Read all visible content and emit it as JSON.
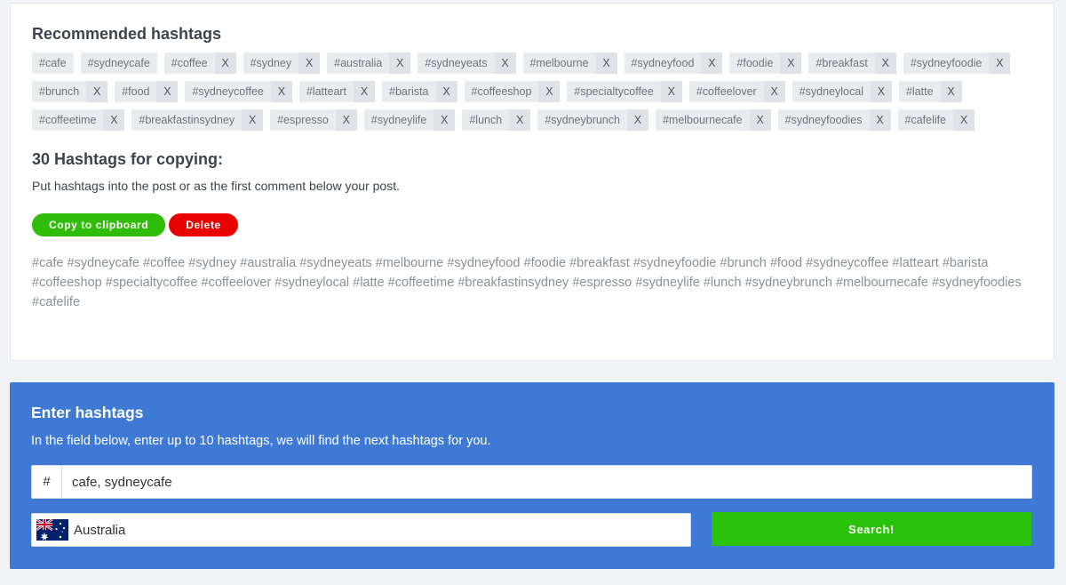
{
  "recommended": {
    "title": "Recommended hashtags",
    "tags": [
      {
        "label": "#cafe",
        "removable": false
      },
      {
        "label": "#sydneycafe",
        "removable": false
      },
      {
        "label": "#coffee",
        "removable": true
      },
      {
        "label": "#sydney",
        "removable": true
      },
      {
        "label": "#australia",
        "removable": true
      },
      {
        "label": "#sydneyeats",
        "removable": true
      },
      {
        "label": "#melbourne",
        "removable": true
      },
      {
        "label": "#sydneyfood",
        "removable": true
      },
      {
        "label": "#foodie",
        "removable": true
      },
      {
        "label": "#breakfast",
        "removable": true
      },
      {
        "label": "#sydneyfoodie",
        "removable": true
      },
      {
        "label": "#brunch",
        "removable": true
      },
      {
        "label": "#food",
        "removable": true
      },
      {
        "label": "#sydneycoffee",
        "removable": true
      },
      {
        "label": "#latteart",
        "removable": true
      },
      {
        "label": "#barista",
        "removable": true
      },
      {
        "label": "#coffeeshop",
        "removable": true
      },
      {
        "label": "#specialtycoffee",
        "removable": true
      },
      {
        "label": "#coffeelover",
        "removable": true
      },
      {
        "label": "#sydneylocal",
        "removable": true
      },
      {
        "label": "#latte",
        "removable": true
      },
      {
        "label": "#coffeetime",
        "removable": true
      },
      {
        "label": "#breakfastinsydney",
        "removable": true
      },
      {
        "label": "#espresso",
        "removable": true
      },
      {
        "label": "#sydneylife",
        "removable": true
      },
      {
        "label": "#lunch",
        "removable": true
      },
      {
        "label": "#sydneybrunch",
        "removable": true
      },
      {
        "label": "#melbournecafe",
        "removable": true
      },
      {
        "label": "#sydneyfoodies",
        "removable": true
      },
      {
        "label": "#cafelife",
        "removable": true
      }
    ],
    "remove_label": "X"
  },
  "copy_section": {
    "title": "30 Hashtags for copying:",
    "note": "Put hashtags into the post or as the first comment below your post.",
    "copy_button": "Copy to clipboard",
    "delete_button": "Delete",
    "text": "#cafe #sydneycafe #coffee #sydney #australia #sydneyeats #melbourne #sydneyfood #foodie #breakfast #sydneyfoodie #brunch #food #sydneycoffee #latteart #barista #coffeeshop #specialtycoffee #coffeelover #sydneylocal #latte #coffeetime #breakfastinsydney #espresso #sydneylife #lunch #sydneybrunch #melbournecafe #sydneyfoodies #cafelife"
  },
  "enter_section": {
    "title": "Enter hashtags",
    "description": "In the field below, enter up to 10 hashtags, we will find the next hashtags for you.",
    "prefix": "#",
    "input_value": "cafe, sydneycafe",
    "country": "Australia",
    "search_button": "Search!"
  },
  "colors": {
    "blue_panel": "#3e79d6",
    "green_button": "#2fbd07",
    "red_button": "#e80000"
  }
}
